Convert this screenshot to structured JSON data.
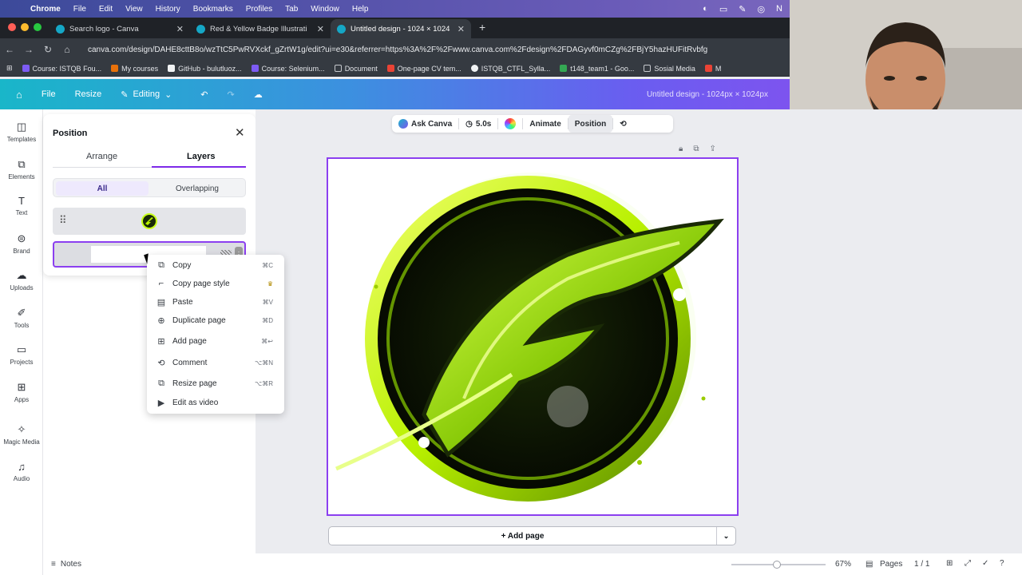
{
  "menubar": {
    "app": "Chrome",
    "items": [
      "File",
      "Edit",
      "View",
      "History",
      "Bookmarks",
      "Profiles",
      "Tab",
      "Window",
      "Help"
    ]
  },
  "tabs": [
    {
      "title": "Search logo - Canva",
      "active": false
    },
    {
      "title": "Red & Yellow Badge Illustrati",
      "active": false
    },
    {
      "title": "Untitled design - 1024 × 1024",
      "active": true
    }
  ],
  "address": {
    "url": "canva.com/design/DAHE8cttB8o/wzTtC5PwRVXckf_gZrtW1g/edit?ui=e30&referrer=https%3A%2F%2Fwww.canva.com%2Fdesign%2FDAGyvf0mCZg%2FBjY5hazHUFitRvbfg"
  },
  "bookmarks": [
    "Course: ISTQB Fou...",
    "My courses",
    "GitHub - bulutluoz...",
    "Course: Selenium...",
    "Document",
    "One-page CV tem...",
    "ISTQB_CTFL_Sylla...",
    "t148_team1 - Goo...",
    "Sosial Media",
    "M"
  ],
  "canva_header": {
    "file": "File",
    "resize": "Resize",
    "editing": "Editing",
    "doc_title": "Untitled design - 1024px × 1024px"
  },
  "rail": [
    {
      "label": "Templates",
      "icon": "templates-icon"
    },
    {
      "label": "Elements",
      "icon": "elements-icon"
    },
    {
      "label": "Text",
      "icon": "text-icon"
    },
    {
      "label": "Brand",
      "icon": "brand-icon"
    },
    {
      "label": "Uploads",
      "icon": "uploads-icon"
    },
    {
      "label": "Tools",
      "icon": "tools-icon"
    },
    {
      "label": "Projects",
      "icon": "projects-icon"
    },
    {
      "label": "Apps",
      "icon": "apps-icon"
    },
    {
      "label": "Magic Media",
      "icon": "magic-media-icon"
    },
    {
      "label": "Audio",
      "icon": "audio-icon"
    }
  ],
  "position_panel": {
    "title": "Position",
    "tabs": [
      "Arrange",
      "Layers"
    ],
    "active_tab": "Layers",
    "filters": [
      "All",
      "Overlapping"
    ],
    "active_filter": "All"
  },
  "toolbar": {
    "ask_canva": "Ask Canva",
    "duration": "5.0s",
    "animate": "Animate",
    "position": "Position"
  },
  "context_menu": [
    {
      "label": "Copy",
      "shortcut": "⌘C",
      "icon": "copy-icon"
    },
    {
      "label": "Copy page style",
      "shortcut": "♛",
      "icon": "paint-roller-icon"
    },
    {
      "label": "Paste",
      "shortcut": "⌘V",
      "icon": "paste-icon"
    },
    {
      "label": "Duplicate page",
      "shortcut": "⌘D",
      "icon": "duplicate-icon"
    },
    {
      "label": "Add page",
      "shortcut": "⌘↩",
      "icon": "add-page-icon"
    },
    {
      "label": "Comment",
      "shortcut": "⌥⌘N",
      "icon": "comment-icon"
    },
    {
      "label": "Resize page",
      "shortcut": "⌥⌘R",
      "icon": "resize-icon"
    },
    {
      "label": "Edit as video",
      "shortcut": "",
      "icon": "video-icon"
    }
  ],
  "add_page": "+ Add page",
  "bottombar": {
    "notes": "Notes",
    "zoom": "67%",
    "pages": "Pages",
    "page_count": "1 / 1"
  },
  "colors": {
    "accent": "#8b3ff0",
    "logo_green": "#b8f000"
  }
}
